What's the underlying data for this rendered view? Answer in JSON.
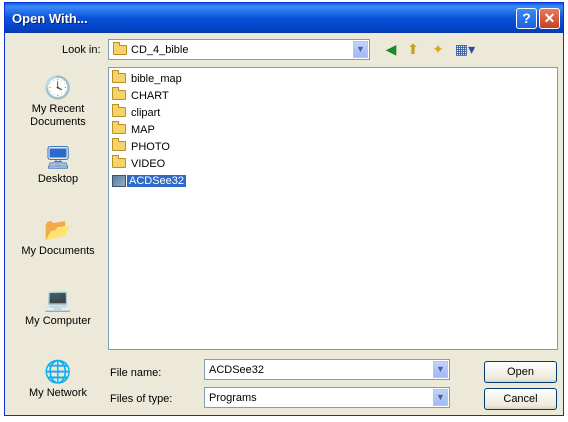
{
  "window": {
    "title": "Open With..."
  },
  "title_buttons": {
    "help": "?",
    "close": "✕"
  },
  "look_in": {
    "label": "Look in:",
    "value": "CD_4_bible"
  },
  "toolbar": {
    "back_icon": "back-icon",
    "up_icon": "up-folder-icon",
    "new_folder_icon": "new-folder-icon",
    "views_icon": "views-menu-icon"
  },
  "places": [
    {
      "label": "My Recent Documents",
      "icon": "recent-documents-icon"
    },
    {
      "label": "Desktop",
      "icon": "desktop-icon"
    },
    {
      "label": "My Documents",
      "icon": "my-documents-icon"
    },
    {
      "label": "My Computer",
      "icon": "my-computer-icon"
    },
    {
      "label": "My Network",
      "icon": "my-network-icon"
    }
  ],
  "items": [
    {
      "label": "bible_map",
      "type": "folder"
    },
    {
      "label": "CHART",
      "type": "folder"
    },
    {
      "label": "clipart",
      "type": "folder"
    },
    {
      "label": "MAP",
      "type": "folder"
    },
    {
      "label": "PHOTO",
      "type": "folder"
    },
    {
      "label": "VIDEO",
      "type": "folder"
    },
    {
      "label": "ACDSee32",
      "type": "application",
      "selected": true
    }
  ],
  "file_name": {
    "label": "File name:",
    "value": "ACDSee32"
  },
  "file_type": {
    "label": "Files of type:",
    "value": "Programs"
  },
  "buttons": {
    "open": "Open",
    "cancel": "Cancel"
  },
  "colors": {
    "titlebar": "#0a53d8",
    "selection": "#316ac5",
    "dialog_bg": "#ece9d8"
  }
}
